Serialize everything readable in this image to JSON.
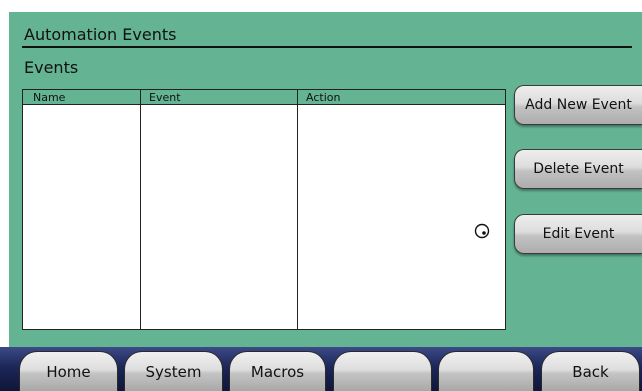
{
  "header": {
    "title": "Automation Events",
    "section": "Events"
  },
  "table": {
    "columns": [
      "Name",
      "Event",
      "Action"
    ],
    "rows": []
  },
  "actions": {
    "add_label": "Add New Event",
    "delete_label": "Delete Event",
    "edit_label": "Edit Event"
  },
  "nav": {
    "home": "Home",
    "system": "System",
    "macros": "Macros",
    "blank1": "",
    "blank2": "",
    "back": "Back"
  },
  "colors": {
    "panel": "#64b494",
    "nav_bar": "#1c2758",
    "button_face": "#dcdcdc"
  },
  "icons": {
    "cursor": "busy-cursor-icon"
  }
}
